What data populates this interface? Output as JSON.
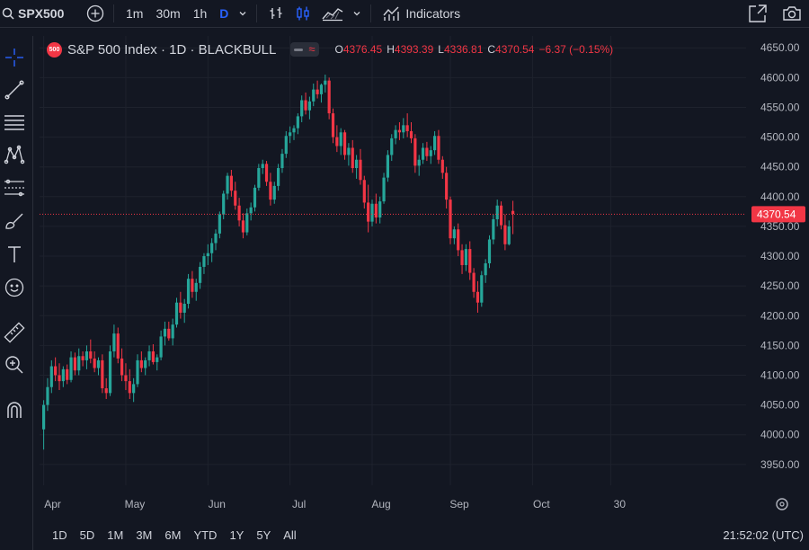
{
  "toolbar": {
    "symbol": "SPX500",
    "intervals": [
      "1m",
      "30m",
      "1h",
      "D"
    ],
    "active_interval": "D",
    "indicators_label": "Indicators"
  },
  "legend": {
    "badge": "500",
    "title": "S&P 500 Index · 1D · BLACKBULL",
    "open_key": "O",
    "open": "4376.45",
    "high_key": "H",
    "high": "4393.39",
    "low_key": "L",
    "low": "4336.81",
    "close_key": "C",
    "close": "4370.54",
    "change": "−6.37 (−0.15%)"
  },
  "price_label": "4370.54",
  "bottom": {
    "ranges": [
      "1D",
      "5D",
      "1M",
      "3M",
      "6M",
      "YTD",
      "1Y",
      "5Y",
      "All"
    ],
    "clock": "21:52:02 (UTC)"
  },
  "colors": {
    "up": "#26a69a",
    "down": "#f23645",
    "background": "#131722",
    "accent": "#2962ff"
  },
  "icons": {
    "left_tools": [
      "crosshair-icon",
      "trendline-icon",
      "fib-retracement-icon",
      "pattern-icon",
      "prediction-icon",
      "brush-icon",
      "text-icon",
      "emoji-icon",
      "ruler-icon",
      "zoom-in-icon",
      "magnet-icon"
    ]
  },
  "chart_data": {
    "type": "candlestick",
    "ylim": [
      3915,
      4670
    ],
    "y_ticks": [
      3950,
      4000,
      4050,
      4100,
      4150,
      4200,
      4250,
      4300,
      4350,
      4400,
      4450,
      4500,
      4550,
      4600,
      4650
    ],
    "y_tick_labels": [
      "3950.00",
      "4000.00",
      "4050.00",
      "4100.00",
      "4150.00",
      "4200.00",
      "4250.00",
      "4300.00",
      "4350.00",
      "4400.00",
      "4450.00",
      "4500.00",
      "4550.00",
      "4600.00",
      "4650.00"
    ],
    "x_tick_labels": [
      "Apr",
      "May",
      "Jun",
      "Jul",
      "Aug",
      "Sep",
      "Oct",
      "30"
    ],
    "x_tick_positions": [
      0,
      21,
      42,
      63,
      84,
      104,
      125,
      145
    ],
    "current_price": 4370.54,
    "candles": [
      [
        4009,
        4058,
        3975,
        4050
      ],
      [
        4050,
        4095,
        4040,
        4080
      ],
      [
        4080,
        4125,
        4070,
        4115
      ],
      [
        4115,
        4130,
        4090,
        4100
      ],
      [
        4100,
        4120,
        4075,
        4090
      ],
      [
        4090,
        4115,
        4080,
        4110
      ],
      [
        4110,
        4118,
        4085,
        4092
      ],
      [
        4092,
        4140,
        4088,
        4130
      ],
      [
        4130,
        4138,
        4100,
        4108
      ],
      [
        4108,
        4145,
        4100,
        4132
      ],
      [
        4132,
        4140,
        4115,
        4125
      ],
      [
        4125,
        4150,
        4110,
        4140
      ],
      [
        4140,
        4160,
        4120,
        4128
      ],
      [
        4128,
        4140,
        4105,
        4112
      ],
      [
        4112,
        4130,
        4100,
        4125
      ],
      [
        4125,
        4135,
        4070,
        4078
      ],
      [
        4078,
        4095,
        4060,
        4070
      ],
      [
        4070,
        4150,
        4065,
        4140
      ],
      [
        4140,
        4185,
        4130,
        4170
      ],
      [
        4170,
        4180,
        4120,
        4128
      ],
      [
        4128,
        4145,
        4090,
        4100
      ],
      [
        4100,
        4120,
        4075,
        4090
      ],
      [
        4090,
        4110,
        4060,
        4070
      ],
      [
        4070,
        4095,
        4055,
        4085
      ],
      [
        4085,
        4135,
        4080,
        4125
      ],
      [
        4125,
        4140,
        4105,
        4112
      ],
      [
        4112,
        4130,
        4100,
        4125
      ],
      [
        4125,
        4150,
        4115,
        4140
      ],
      [
        4140,
        4152,
        4118,
        4122
      ],
      [
        4122,
        4135,
        4108,
        4130
      ],
      [
        4130,
        4175,
        4125,
        4165
      ],
      [
        4165,
        4190,
        4150,
        4178
      ],
      [
        4178,
        4190,
        4158,
        4162
      ],
      [
        4162,
        4195,
        4150,
        4185
      ],
      [
        4185,
        4230,
        4180,
        4222
      ],
      [
        4222,
        4240,
        4195,
        4205
      ],
      [
        4205,
        4228,
        4188,
        4220
      ],
      [
        4220,
        4270,
        4212,
        4262
      ],
      [
        4262,
        4275,
        4230,
        4240
      ],
      [
        4240,
        4262,
        4225,
        4255
      ],
      [
        4255,
        4290,
        4245,
        4282
      ],
      [
        4282,
        4305,
        4270,
        4300
      ],
      [
        4300,
        4320,
        4285,
        4305
      ],
      [
        4305,
        4330,
        4290,
        4322
      ],
      [
        4322,
        4345,
        4310,
        4338
      ],
      [
        4338,
        4375,
        4330,
        4370
      ],
      [
        4370,
        4410,
        4362,
        4405
      ],
      [
        4405,
        4440,
        4395,
        4435
      ],
      [
        4435,
        4445,
        4400,
        4410
      ],
      [
        4410,
        4425,
        4378,
        4385
      ],
      [
        4385,
        4398,
        4350,
        4360
      ],
      [
        4360,
        4372,
        4330,
        4340
      ],
      [
        4340,
        4380,
        4335,
        4372
      ],
      [
        4372,
        4390,
        4360,
        4382
      ],
      [
        4382,
        4420,
        4375,
        4415
      ],
      [
        4415,
        4455,
        4410,
        4448
      ],
      [
        4448,
        4462,
        4438,
        4455
      ],
      [
        4455,
        4460,
        4418,
        4425
      ],
      [
        4425,
        4440,
        4385,
        4395
      ],
      [
        4395,
        4425,
        4388,
        4418
      ],
      [
        4418,
        4455,
        4410,
        4448
      ],
      [
        4448,
        4480,
        4440,
        4472
      ],
      [
        4472,
        4510,
        4465,
        4502
      ],
      [
        4502,
        4518,
        4490,
        4508
      ],
      [
        4508,
        4520,
        4495,
        4515
      ],
      [
        4515,
        4540,
        4505,
        4535
      ],
      [
        4535,
        4570,
        4525,
        4562
      ],
      [
        4562,
        4575,
        4538,
        4545
      ],
      [
        4545,
        4568,
        4530,
        4560
      ],
      [
        4560,
        4590,
        4552,
        4580
      ],
      [
        4580,
        4595,
        4565,
        4572
      ],
      [
        4572,
        4590,
        4558,
        4588
      ],
      [
        4588,
        4605,
        4575,
        4595
      ],
      [
        4595,
        4600,
        4530,
        4540
      ],
      [
        4540,
        4548,
        4490,
        4500
      ],
      [
        4500,
        4520,
        4475,
        4485
      ],
      [
        4485,
        4515,
        4470,
        4508
      ],
      [
        4508,
        4512,
        4462,
        4470
      ],
      [
        4470,
        4490,
        4452,
        4482
      ],
      [
        4482,
        4495,
        4440,
        4448
      ],
      [
        4448,
        4470,
        4430,
        4462
      ],
      [
        4462,
        4480,
        4420,
        4428
      ],
      [
        4428,
        4435,
        4380,
        4390
      ],
      [
        4390,
        4420,
        4340,
        4358
      ],
      [
        4358,
        4395,
        4350,
        4388
      ],
      [
        4388,
        4405,
        4355,
        4365
      ],
      [
        4365,
        4400,
        4355,
        4392
      ],
      [
        4392,
        4440,
        4388,
        4432
      ],
      [
        4432,
        4478,
        4425,
        4470
      ],
      [
        4470,
        4505,
        4460,
        4498
      ],
      [
        4498,
        4520,
        4488,
        4512
      ],
      [
        4512,
        4525,
        4495,
        4508
      ],
      [
        4508,
        4532,
        4498,
        4520
      ],
      [
        4520,
        4540,
        4500,
        4510
      ],
      [
        4510,
        4525,
        4490,
        4498
      ],
      [
        4498,
        4505,
        4440,
        4452
      ],
      [
        4452,
        4470,
        4435,
        4462
      ],
      [
        4462,
        4490,
        4455,
        4482
      ],
      [
        4482,
        4492,
        4460,
        4468
      ],
      [
        4468,
        4485,
        4455,
        4478
      ],
      [
        4478,
        4510,
        4470,
        4502
      ],
      [
        4502,
        4512,
        4455,
        4462
      ],
      [
        4462,
        4468,
        4430,
        4440
      ],
      [
        4440,
        4450,
        4380,
        4395
      ],
      [
        4395,
        4400,
        4320,
        4330
      ],
      [
        4330,
        4350,
        4320,
        4345
      ],
      [
        4345,
        4355,
        4300,
        4310
      ],
      [
        4310,
        4320,
        4270,
        4285
      ],
      [
        4285,
        4320,
        4275,
        4312
      ],
      [
        4312,
        4325,
        4260,
        4272
      ],
      [
        4272,
        4280,
        4230,
        4240
      ],
      [
        4240,
        4258,
        4205,
        4222
      ],
      [
        4222,
        4275,
        4215,
        4268
      ],
      [
        4268,
        4295,
        4255,
        4288
      ],
      [
        4288,
        4335,
        4280,
        4328
      ],
      [
        4328,
        4370,
        4320,
        4362
      ],
      [
        4362,
        4395,
        4350,
        4385
      ],
      [
        4385,
        4392,
        4345,
        4352
      ],
      [
        4352,
        4370,
        4310,
        4320
      ],
      [
        4320,
        4360,
        4318,
        4350
      ],
      [
        4376,
        4393,
        4337,
        4371
      ]
    ]
  }
}
